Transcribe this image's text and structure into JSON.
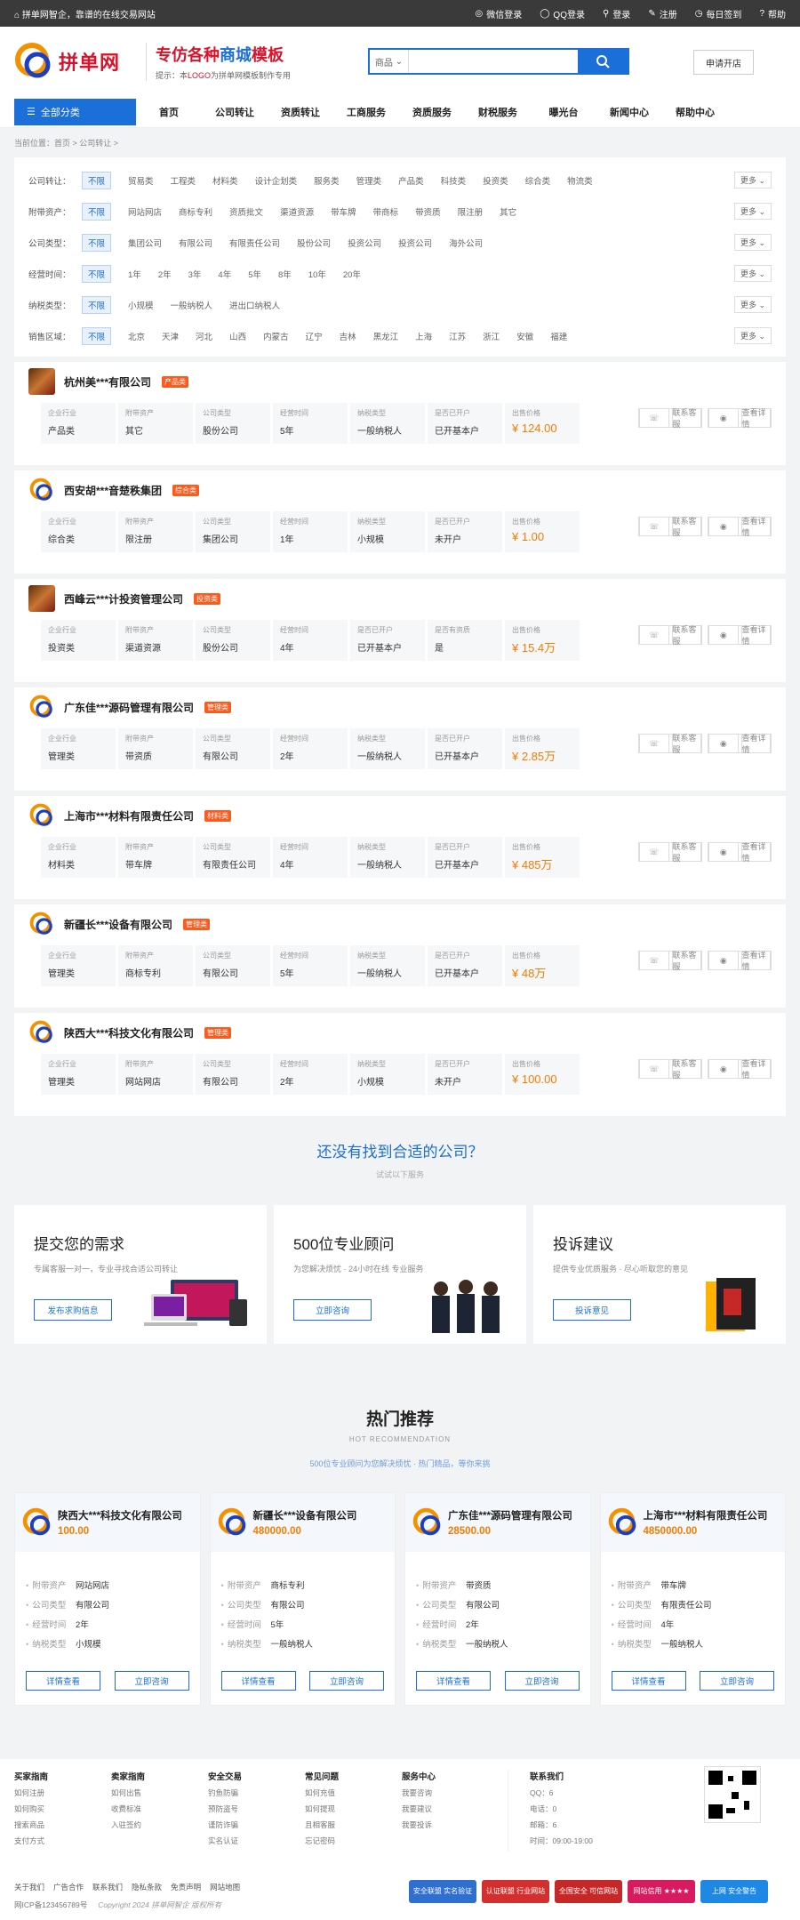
{
  "topbar": {
    "welcome": "拼单网智企，靠谱的在线交易网站",
    "links": [
      "微信登录",
      "QQ登录",
      "登录",
      "注册",
      "每日签到",
      "帮助"
    ]
  },
  "header": {
    "logo_text": "拼单网",
    "slogan_prefix": "专仿各种",
    "slogan_strong": "商城",
    "slogan_suffix": "模板",
    "tip_prefix": "提示：本",
    "tip_em": "LOGO",
    "tip_suffix": "为拼单网模板制作专用",
    "search_select": "商品",
    "search_placeholder": "",
    "apply_button": "申请开店"
  },
  "nav": {
    "all_label": "全部分类",
    "items": [
      "首页",
      "公司转让",
      "资质转让",
      "工商服务",
      "资质服务",
      "财税服务",
      "曝光台",
      "新闻中心",
      "帮助中心"
    ]
  },
  "breadcrumb": "当前位置：首页 > 公司转让 >",
  "filters": [
    {
      "label": "公司转让：",
      "options": [
        "不限",
        "贸易类",
        "工程类",
        "材料类",
        "设计企划类",
        "服务类",
        "管理类",
        "产品类",
        "科技类",
        "投资类",
        "综合类",
        "物流类"
      ],
      "more": "更多"
    },
    {
      "label": "附带资产：",
      "options": [
        "不限",
        "网站网店",
        "商标专利",
        "资质批文",
        "渠道资源",
        "带车牌",
        "带商标",
        "带资质",
        "限注册",
        "其它"
      ],
      "more": "更多"
    },
    {
      "label": "公司类型：",
      "options": [
        "不限",
        "集团公司",
        "有限公司",
        "有限责任公司",
        "股份公司",
        "投资公司",
        "投资公司",
        "海外公司"
      ],
      "more": "更多"
    },
    {
      "label": "经营时间：",
      "options": [
        "不限",
        "1年",
        "2年",
        "3年",
        "4年",
        "5年",
        "8年",
        "10年",
        "20年"
      ],
      "more": "更多"
    },
    {
      "label": "纳税类型：",
      "options": [
        "不限",
        "小规模",
        "一般纳税人",
        "进出口纳税人"
      ],
      "more": "更多"
    },
    {
      "label": "销售区域：",
      "options": [
        "不限",
        "北京",
        "天津",
        "河北",
        "山西",
        "内蒙古",
        "辽宁",
        "吉林",
        "黑龙江",
        "上海",
        "江苏",
        "浙江",
        "安徽",
        "福建"
      ],
      "more": "更多"
    }
  ],
  "cell_labels": [
    "企业行业",
    "附带资产",
    "公司类型",
    "经营时间",
    "纳税类型",
    "是否已开户",
    "出售价格"
  ],
  "cell_labels_alt": [
    "企业行业",
    "附带资产",
    "公司类型",
    "经营时间",
    "是否已开户",
    "是否有资质",
    "出售价格"
  ],
  "action_buttons": {
    "contact": "联系客服",
    "detail": "查看详情"
  },
  "companies": [
    {
      "name": "杭州美***有限公司",
      "tag": "产品类",
      "avatar": "photo",
      "values": [
        "产品类",
        "其它",
        "股份公司",
        "5年",
        "一般纳税人",
        "已开基本户",
        "¥ 124.00"
      ],
      "alt": false
    },
    {
      "name": "西安胡***音楚秩集团",
      "tag": "综合类",
      "avatar": "logo",
      "values": [
        "综合类",
        "限注册",
        "集团公司",
        "1年",
        "小规模",
        "未开户",
        "¥ 1.00"
      ],
      "alt": false
    },
    {
      "name": "西峰云***计投资管理公司",
      "tag": "投资类",
      "avatar": "photo",
      "values": [
        "投资类",
        "渠道资源",
        "股份公司",
        "4年",
        "已开基本户",
        "是",
        "¥ 15.4万"
      ],
      "alt": true
    },
    {
      "name": "广东佳***源码管理有限公司",
      "tag": "管理类",
      "avatar": "logo",
      "values": [
        "管理类",
        "带资质",
        "有限公司",
        "2年",
        "一般纳税人",
        "已开基本户",
        "¥ 2.85万"
      ],
      "alt": false
    },
    {
      "name": "上海市***材料有限责任公司",
      "tag": "材料类",
      "avatar": "logo",
      "values": [
        "材料类",
        "带车牌",
        "有限责任公司",
        "4年",
        "一般纳税人",
        "已开基本户",
        "¥ 485万"
      ],
      "alt": false
    },
    {
      "name": "新疆长***设备有限公司",
      "tag": "管理类",
      "avatar": "logo",
      "values": [
        "管理类",
        "商标专利",
        "有限公司",
        "5年",
        "一般纳税人",
        "已开基本户",
        "¥ 48万"
      ],
      "alt": false
    },
    {
      "name": "陕西大***科技文化有限公司",
      "tag": "管理类",
      "avatar": "logo",
      "values": [
        "管理类",
        "网站网店",
        "有限公司",
        "2年",
        "小规模",
        "未开户",
        "¥ 100.00"
      ],
      "alt": false
    }
  ],
  "notfound": {
    "title": "还没有找到合适的公司？",
    "sub": "试试以下服务"
  },
  "services": [
    {
      "title": "提交您的需求",
      "desc": "专属客服一对一，专业寻找合适公司转让",
      "button": "发布求购信息"
    },
    {
      "title": "500位专业顾问",
      "desc": "为您解决烦忧 · 24小时在线 专业服务",
      "button": "立即咨询"
    },
    {
      "title": "投诉建议",
      "desc": "提供专业优质服务 · 尽心听取您的意见",
      "button": "投诉意见"
    }
  ],
  "hot": {
    "title": "热门推荐",
    "en": "HOT RECOMMENDATION",
    "desc": "500位专业顾问为您解决烦忧 · 热门精品，等你来挑"
  },
  "rec_labels": [
    "附带资产",
    "公司类型",
    "经营时间",
    "纳税类型"
  ],
  "rec_buttons": {
    "detail": "详情查看",
    "consult": "立即咨询"
  },
  "recommendations": [
    {
      "name": "陕西大***科技文化有限公司",
      "price": "100.00",
      "values": [
        "网站网店",
        "有限公司",
        "2年",
        "小规模"
      ]
    },
    {
      "name": "新疆长***设备有限公司",
      "price": "480000.00",
      "values": [
        "商标专利",
        "有限公司",
        "5年",
        "一般纳税人"
      ]
    },
    {
      "name": "广东佳***源码管理有限公司",
      "price": "28500.00",
      "values": [
        "带资质",
        "有限公司",
        "2年",
        "一般纳税人"
      ]
    },
    {
      "name": "上海市***材料有限责任公司",
      "price": "4850000.00",
      "values": [
        "带车牌",
        "有限责任公司",
        "4年",
        "一般纳税人"
      ]
    }
  ],
  "footer": {
    "columns": [
      {
        "title": "买家指南",
        "items": [
          "如何注册",
          "如何购买",
          "搜索商品",
          "支付方式"
        ]
      },
      {
        "title": "卖家指南",
        "items": [
          "如何出售",
          "收费标准",
          "入驻签约",
          ""
        ]
      },
      {
        "title": "安全交易",
        "items": [
          "钓鱼防骗",
          "预防盗号",
          "谨防诈骗",
          "实名认证"
        ]
      },
      {
        "title": "常见问题",
        "items": [
          "如何充值",
          "如何提现",
          "且相客服",
          "忘记密码"
        ]
      },
      {
        "title": "服务中心",
        "items": [
          "我要咨询",
          "我要建议",
          "我要投诉",
          ""
        ]
      }
    ],
    "contact_title": "联系我们",
    "contact_items": [
      "QQ：6",
      "电话：0",
      "邮箱：6",
      "时间：09:00-19:00"
    ],
    "links": [
      "关于我们",
      "广告合作",
      "联系我们",
      "隐私条款",
      "免责声明",
      "网站地图"
    ],
    "icp": "网ICP备123456789号",
    "copyright": "Copyright 2024 拼单网智企 版权所有",
    "badges": [
      "安全联盟 实名验证",
      "认证联盟 行业网站",
      "全国安全 可信网站",
      "网站信用 ★★★★",
      "上网 安全警告"
    ]
  }
}
